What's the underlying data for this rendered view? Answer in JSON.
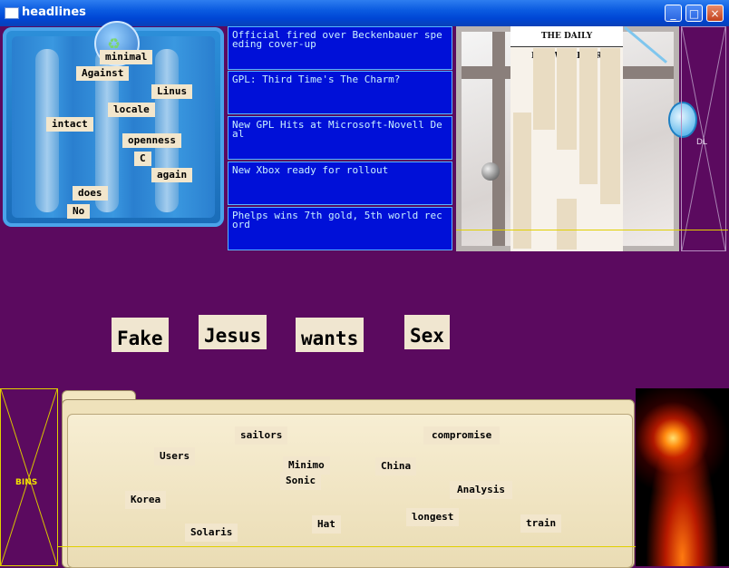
{
  "window": {
    "title": "headlines",
    "controls": [
      "_",
      "□",
      "×"
    ]
  },
  "word_box": {
    "words": [
      "minimal",
      "Against",
      "Linus",
      "locale",
      "intact",
      "openness",
      "C",
      "again",
      "does",
      "No"
    ]
  },
  "headlines": [
    "Official fired over Beckenbauer speeding cover-up",
    "GPL: Third Time's The Charm?",
    "New GPL Hits at Microsoft-Novell Deal",
    "New Xbox ready for rollout",
    "Phelps wins 7th gold, 5th world record"
  ],
  "newspaper": {
    "masthead": "THE DAILY FISHWRAPPER"
  },
  "dl_label": "DL",
  "sentence": {
    "words": [
      "Fake",
      "Jesus",
      "wants",
      "Sex"
    ]
  },
  "bins_label": "BINS",
  "folder": {
    "words": [
      "sailors",
      "compromise",
      "Users",
      "Minimo",
      "China",
      "Sonic",
      "Analysis",
      "Korea",
      "longest",
      "Hat",
      "train",
      "Solaris"
    ]
  }
}
